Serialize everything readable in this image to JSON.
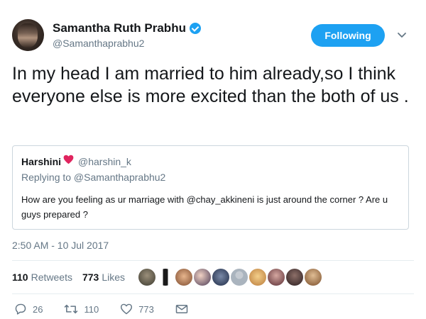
{
  "header": {
    "display_name": "Samantha Ruth Prabhu",
    "handle": "@Samanthaprabhu2",
    "follow_label": "Following"
  },
  "tweet": {
    "text": "In my head I am married to him already,so I think everyone else is more excited than the both of us ."
  },
  "quoted": {
    "name": "Harshini",
    "handle": "@harshin_k",
    "reply_to": "Replying to @Samanthaprabhu2",
    "text": "How are you feeling as ur marriage with @chay_akkineni is just around the corner ? Are u guys prepared ?"
  },
  "timestamp": "2:50 AM - 10 Jul 2017",
  "stats": {
    "retweets_count": "110",
    "retweets_label": "Retweets",
    "likes_count": "773",
    "likes_label": "Likes"
  },
  "actions": {
    "reply_count": "26",
    "retweet_count": "110",
    "like_count": "773"
  },
  "colors": {
    "accent": "#1da1f2",
    "text_primary": "#14171a",
    "text_secondary": "#657786",
    "border": "#ccd6dd",
    "heart_emoji": "#e0245e"
  },
  "icons": [
    "verified-badge-icon",
    "chevron-down-icon",
    "red-heart-emoji",
    "reply-icon",
    "retweet-icon",
    "like-icon",
    "direct-message-icon"
  ],
  "liker_avatar_count": 10
}
